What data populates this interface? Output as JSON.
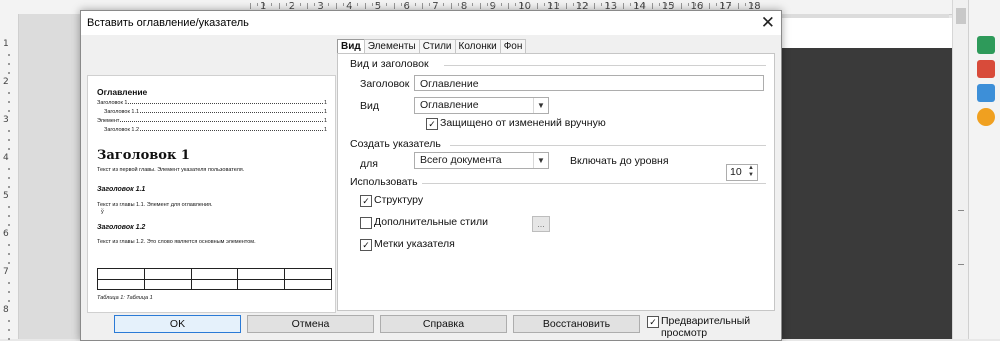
{
  "editor": {
    "ruler_numbers": [
      "1",
      "2",
      "3",
      "4",
      "5",
      "6",
      "7",
      "8",
      "9",
      "10",
      "11",
      "12",
      "13",
      "14",
      "15",
      "16",
      "17",
      "18"
    ],
    "left_ruler_numbers": [
      "1",
      "2",
      "3",
      "4",
      "5",
      "6",
      "7",
      "8"
    ]
  },
  "dialog": {
    "title": "Вставить оглавление/указатель",
    "tabs": [
      {
        "label": "Вид",
        "active": true
      },
      {
        "label": "Элементы",
        "active": false
      },
      {
        "label": "Стили",
        "active": false
      },
      {
        "label": "Колонки",
        "active": false
      },
      {
        "label": "Фон",
        "active": false
      }
    ],
    "preview": {
      "toc_title": "Оглавление",
      "toc_lines": [
        {
          "text": "Заголовок 1",
          "page": "1"
        },
        {
          "text": "Заголовок 1.1",
          "page": "1"
        },
        {
          "text": "Элемент",
          "page": "1"
        },
        {
          "text": "Заголовок 1.2",
          "page": "1"
        }
      ],
      "heading1": "Заголовок 1",
      "text1": "Текст из первой главы. Элемент указателя пользователя.",
      "heading11": "Заголовок 1.1",
      "text11": "Текст из главы 1.1. Элемент для оглавления.",
      "marker": "ў",
      "heading12": "Заголовок 1.2",
      "text12": "Текст из главы 1.2. Это слово является основным элементом.",
      "caption": "Таблица 1: Таблица 1"
    },
    "type_and_title": {
      "section_label": "Вид и заголовок",
      "title_label": "Заголовок",
      "title_value": "Оглавление",
      "type_label": "Вид",
      "type_value": "Оглавление",
      "protected_label": "Защищено от изменений вручную",
      "protected_checked": true
    },
    "create_index": {
      "section_label": "Создать указатель",
      "for_label": "для",
      "for_value": "Всего документа",
      "level_label": "Включать до уровня",
      "level_value": "10"
    },
    "use": {
      "section_label": "Использовать",
      "structure_label": "Структуру",
      "structure_checked": true,
      "additional_styles_label": "Дополнительные стили",
      "additional_styles_checked": false,
      "additional_styles_btn": "...",
      "index_marks_label": "Метки указателя",
      "index_marks_checked": true
    },
    "buttons": {
      "ok": "OK",
      "cancel": "Отмена",
      "help": "Справка",
      "reset": "Восстановить",
      "preview_label": "Предварительный просмотр",
      "preview_checked": true
    },
    "check_mark": "✓"
  }
}
